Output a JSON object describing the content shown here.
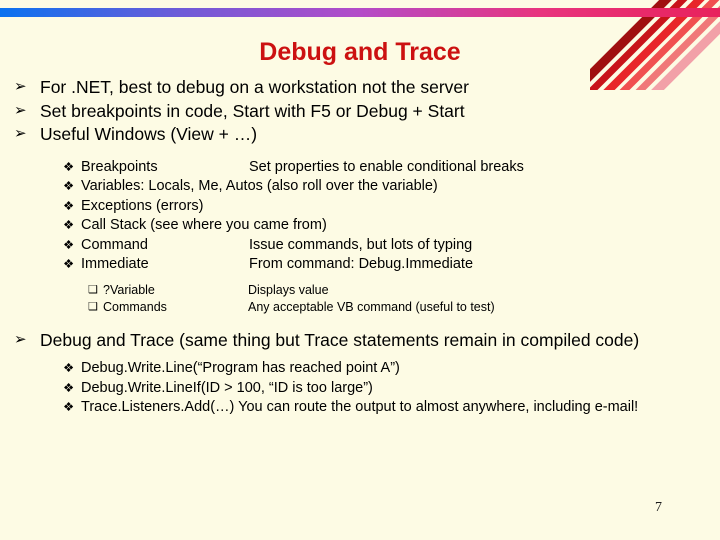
{
  "slide": {
    "title": "Debug and Trace",
    "page_number": "7",
    "background_color": "#FDFBE4",
    "title_color": "#CC1111"
  },
  "decor": {
    "top_bar_gradient": [
      "#0A72F0",
      "#6E5BD8",
      "#B44BC8",
      "#E8347E",
      "#E8225C"
    ],
    "stripe_colors": [
      "#A01010",
      "#C8141A",
      "#E8262A",
      "#F05050",
      "#F07878",
      "#F2A0A8",
      "#E81A6E"
    ]
  },
  "markers": {
    "level1": "➢",
    "level2": "❖",
    "level3": "❑"
  },
  "content": {
    "level1_top": [
      "For .NET, best to debug on a workstation not the server",
      "Set breakpoints in code, Start with F5 or Debug + Start",
      "Useful Windows (View + …)"
    ],
    "windows_list": [
      {
        "name": "Breakpoints",
        "desc": "Set properties to enable conditional breaks"
      },
      {
        "name": "Variables: Locals, Me, Autos (also roll over the variable)",
        "desc": ""
      },
      {
        "name": "Exceptions (errors)",
        "desc": ""
      },
      {
        "name": "Call Stack (see where you came from)",
        "desc": ""
      },
      {
        "name": "Command",
        "desc": "Issue commands, but lots of typing"
      },
      {
        "name": "Immediate",
        "desc": "From command: Debug.Immediate"
      }
    ],
    "immediate_sub": [
      {
        "name": "?Variable",
        "desc": "Displays value"
      },
      {
        "name": "Commands",
        "desc": "Any acceptable VB command (useful to test)"
      }
    ],
    "trace_heading": "Debug and Trace (same thing but Trace statements remain in compiled code)",
    "trace_examples": [
      "Debug.Write.Line(“Program has reached point A”)",
      "Debug.Write.LineIf(ID > 100, “ID is too large”)",
      "Trace.Listeners.Add(…) You can route the output to almost anywhere, including e-mail!"
    ]
  }
}
